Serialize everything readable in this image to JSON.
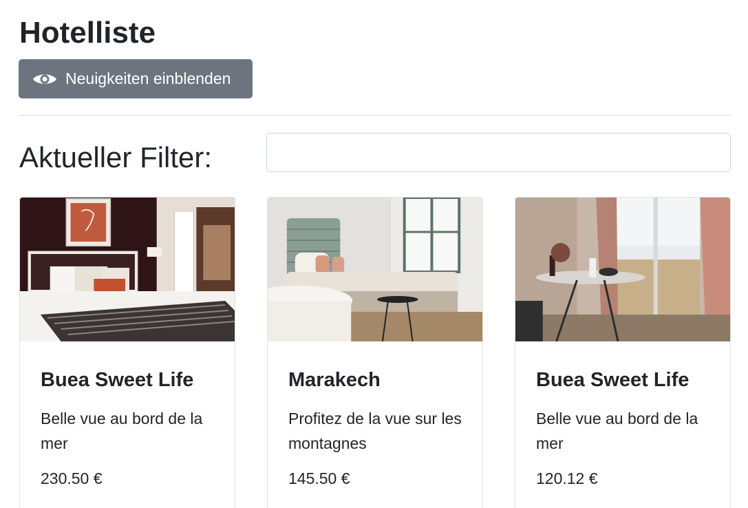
{
  "header": {
    "title": "Hotelliste",
    "news_button_label": "Neuigkeiten einblenden",
    "news_button_icon": "eye-icon"
  },
  "filter": {
    "label": "Aktueller Filter:",
    "value": "",
    "placeholder": ""
  },
  "hotels": [
    {
      "name": "Buea Sweet Life",
      "description": "Belle vue au bord de la mer",
      "price": "230.50 €",
      "image": "bedroom-dark-wall-photo"
    },
    {
      "name": "Marakech",
      "description": "Profitez de la vue sur les montagnes",
      "price": "145.50 €",
      "image": "bright-bedroom-bathtub-photo"
    },
    {
      "name": "Buea Sweet Life",
      "description": "Belle vue au bord de la mer",
      "price": "120.12 €",
      "image": "dining-table-window-view-photo"
    }
  ],
  "colors": {
    "button_bg": "#6c757d",
    "text": "#212529",
    "border": "#dfe2e5"
  }
}
